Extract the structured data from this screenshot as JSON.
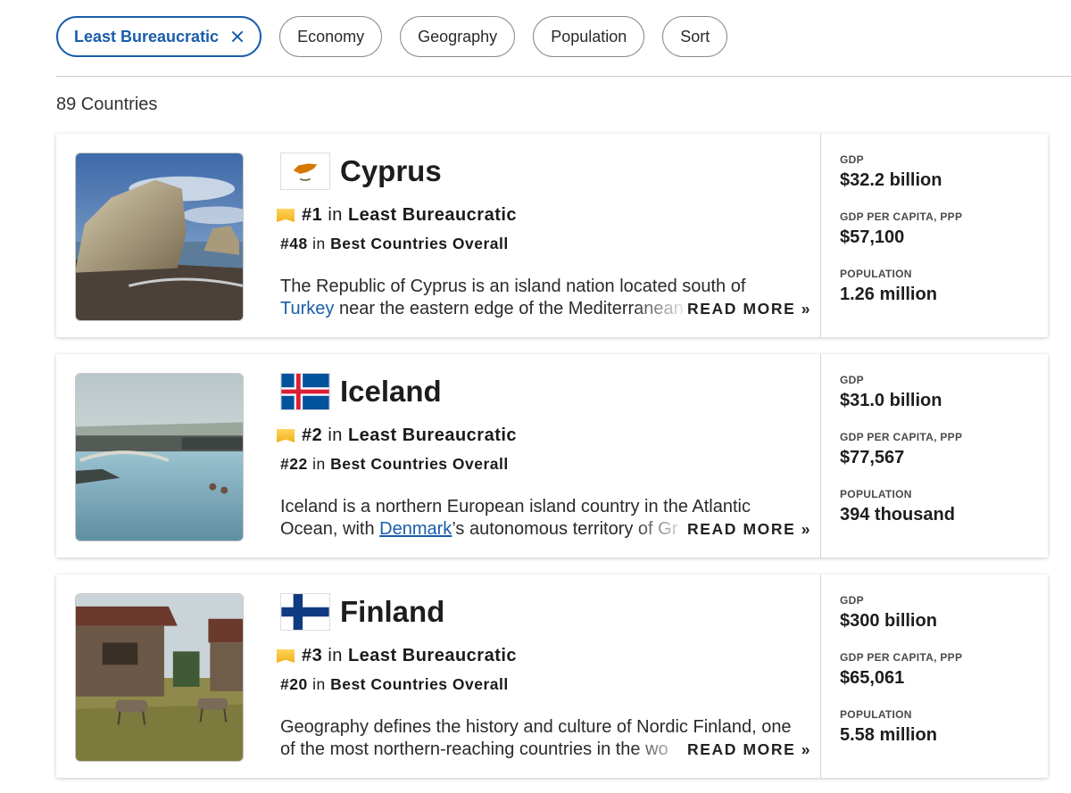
{
  "filters": [
    {
      "label": "Least Bureaucratic",
      "active": true
    },
    {
      "label": "Economy"
    },
    {
      "label": "Geography"
    },
    {
      "label": "Population"
    },
    {
      "label": "Sort"
    }
  ],
  "count_text": "89 Countries",
  "read_more": "READ MORE »",
  "in_word": "in",
  "stat_labels": {
    "gdp": "GDP",
    "gdp_ppp": "GDP PER CAPITA, PPP",
    "population": "POPULATION"
  },
  "countries": [
    {
      "name": "Cyprus",
      "rank_category": "#1",
      "category": "Least Bureaucratic",
      "rank_overall": "#48",
      "overall": "Best Countries Overall",
      "desc_line1": "The Republic of Cyprus is an island nation located south of",
      "desc_link": "Turkey",
      "desc_line2_rest": " near the eastern edge of the Mediterranean",
      "gdp": "$32.2 billion",
      "gdp_ppp": "$57,100",
      "population": "1.26 million",
      "flag_icon": "cyprus-flag-icon"
    },
    {
      "name": "Iceland",
      "rank_category": "#2",
      "category": "Least Bureaucratic",
      "rank_overall": "#22",
      "overall": "Best Countries Overall",
      "desc_line1": "Iceland is a northern European island country in the Atlantic",
      "desc_prefix": "Ocean, with ",
      "desc_link": "Denmark",
      "desc_line2_rest": "’s autonomous territory of Gr",
      "gdp": "$31.0 billion",
      "gdp_ppp": "$77,567",
      "population": "394 thousand",
      "flag_icon": "iceland-flag-icon"
    },
    {
      "name": "Finland",
      "rank_category": "#3",
      "category": "Least Bureaucratic",
      "rank_overall": "#20",
      "overall": "Best Countries Overall",
      "desc_line1": "Geography defines the history and culture of Nordic Finland, one",
      "desc_line2": "of the most northern-reaching countries in the wo",
      "gdp": "$300 billion",
      "gdp_ppp": "$65,061",
      "population": "5.58 million",
      "flag_icon": "finland-flag-icon"
    }
  ],
  "colors": {
    "accent": "#1a5dab",
    "ribbon": "#f2b21d"
  }
}
